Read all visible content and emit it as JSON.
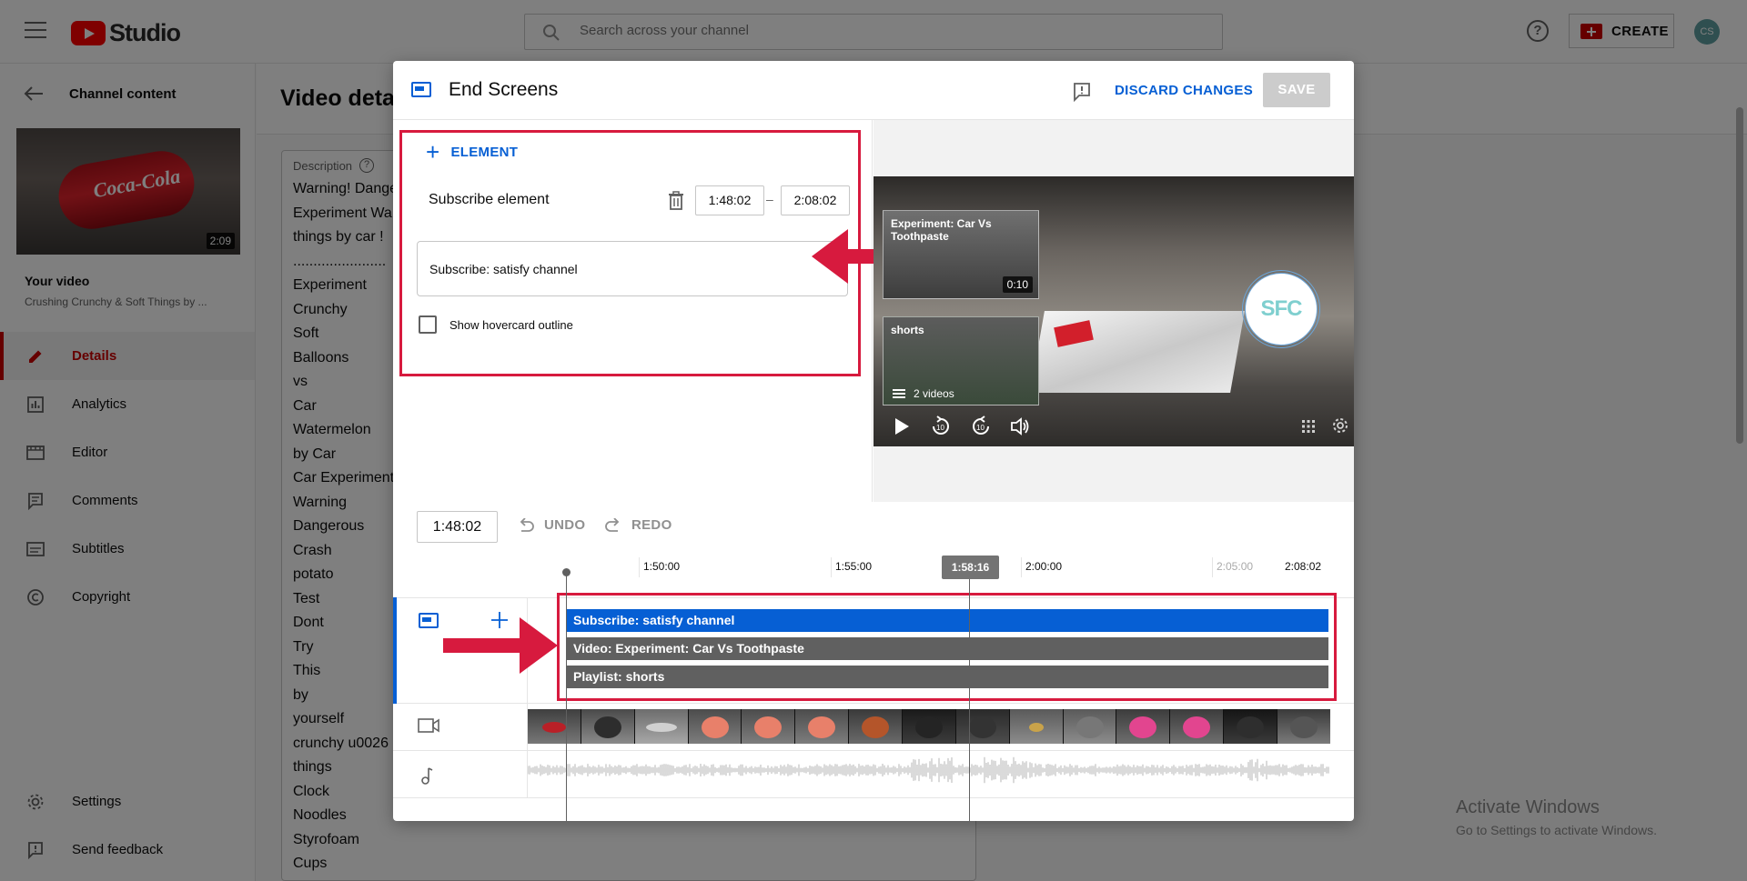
{
  "topbar": {
    "logo_text": "Studio",
    "search_placeholder": "Search across your channel",
    "help_label": "?",
    "create_label": "CREATE",
    "avatar_text": "CS"
  },
  "sidebar": {
    "back_label": "Channel content",
    "thumb_duration": "2:09",
    "thumb_text": "Coca-Cola",
    "your_video_label": "Your video",
    "video_title": "Crushing Crunchy & Soft Things by ...",
    "items": [
      {
        "label": "Details",
        "icon": "pencil-icon",
        "active": true
      },
      {
        "label": "Analytics",
        "icon": "analytics-icon"
      },
      {
        "label": "Editor",
        "icon": "editor-icon"
      },
      {
        "label": "Comments",
        "icon": "comments-icon"
      },
      {
        "label": "Subtitles",
        "icon": "subtitles-icon"
      },
      {
        "label": "Copyright",
        "icon": "copyright-icon"
      }
    ],
    "bottom_items": [
      {
        "label": "Settings",
        "icon": "gear-icon"
      },
      {
        "label": "Send feedback",
        "icon": "feedback-icon"
      }
    ]
  },
  "main": {
    "title": "Video deta",
    "description_label": "Description",
    "description_lines": [
      "Warning! Dange",
      "Experiment Wa",
      "things by car !",
      ".......................",
      "Experiment",
      "Crunchy",
      "Soft",
      "Balloons",
      "vs",
      "Car",
      "Watermelon",
      "by Car",
      "Car Experiment",
      "Warning",
      "Dangerous",
      "Crash",
      "potato",
      "Test",
      "Dont",
      "Try",
      "This",
      "by",
      "yourself",
      "crunchy u0026",
      "things",
      "Clock",
      "Noodles",
      "Styrofoam",
      "Cups"
    ]
  },
  "modal": {
    "title": "End Screens",
    "discard_label": "DISCARD CHANGES",
    "save_label": "SAVE",
    "add_element_label": "ELEMENT",
    "element_name": "Subscribe element",
    "start_time": "1:48:02",
    "end_time": "2:08:02",
    "dash": "–",
    "subscribe_field": "Subscribe: satisfy channel",
    "hovercard_label": "Show hovercard outline",
    "hovercard_checked": false
  },
  "preview": {
    "card_video_title": "Experiment: Car Vs Toothpaste",
    "card_video_duration": "0:10",
    "card_playlist_title": "shorts",
    "card_playlist_count": "2 videos",
    "subscribe_logo_text": "SFC"
  },
  "timeline": {
    "current_time": "1:48:02",
    "undo_label": "UNDO",
    "redo_label": "REDO",
    "ruler": [
      "1:50:00",
      "1:55:00",
      "2:00:00",
      "2:05:00",
      "2:08:02"
    ],
    "playhead": "1:58:16",
    "bars": [
      {
        "label": "Subscribe: satisfy channel",
        "color": "#065fd4"
      },
      {
        "label": "Video: Experiment: Car Vs Toothpaste",
        "color": "#606060"
      },
      {
        "label": "Playlist: shorts",
        "color": "#606060"
      }
    ]
  },
  "windows": {
    "line1": "Activate Windows",
    "line2": "Go to Settings to activate Windows."
  },
  "colors": {
    "accent": "#065fd4",
    "brand_red": "#cc0000",
    "annotation_red": "#d71a3e"
  }
}
